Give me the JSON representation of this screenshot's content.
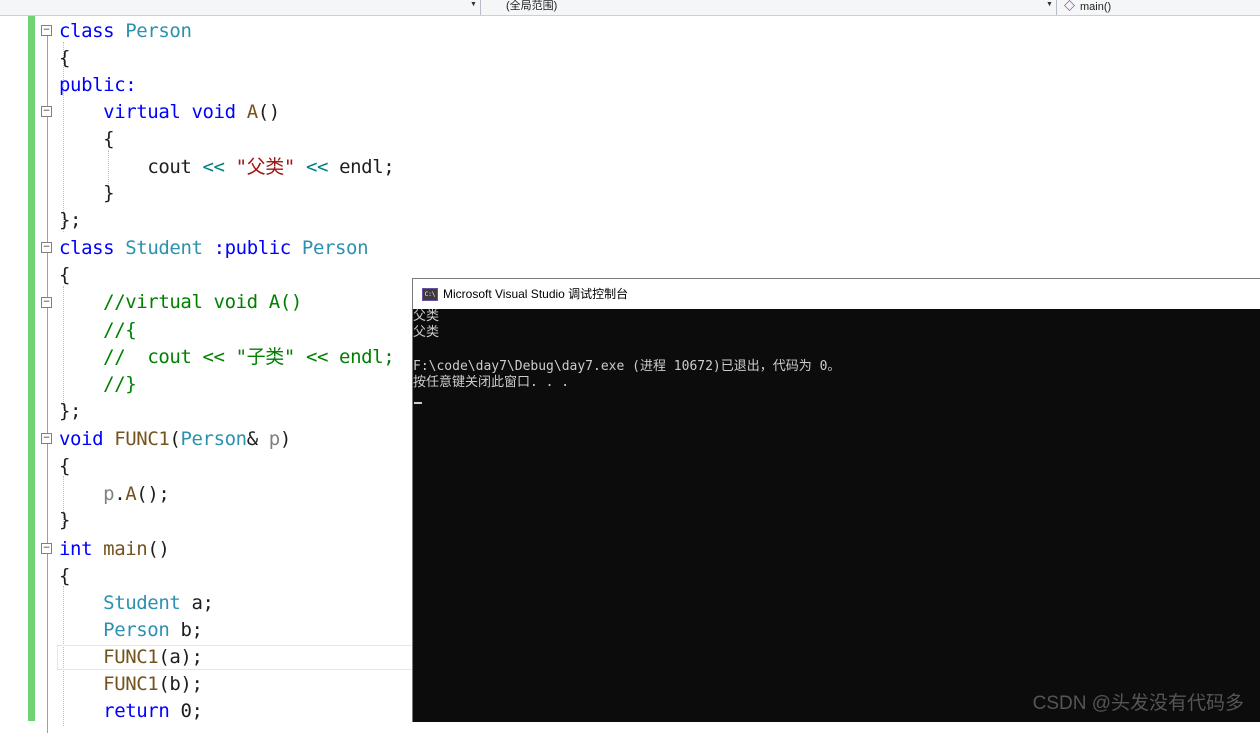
{
  "navbar": {
    "scope_label": "(全局范围)",
    "member_label": "main()"
  },
  "code": {
    "l1": "class",
    "l1b": "Person",
    "l2": "{",
    "l3": "public:",
    "l4a": "virtual",
    "l4b": "void",
    "l4c": "A",
    "l4d": "()",
    "l5": "{",
    "l6a": "cout",
    "l6b": "<<",
    "l6c": "\"父类\"",
    "l6d": "<<",
    "l6e": "endl;",
    "l7": "}",
    "l8": "};",
    "l9a": "class",
    "l9b": "Student",
    "l9c": ":public",
    "l9d": "Person",
    "l10": "{",
    "l11": "//virtual void A()",
    "l12": "//{",
    "l13a": "//",
    "l13b": "cout << \"子类\" << endl;",
    "l14": "//}",
    "l15": "};",
    "l16a": "void",
    "l16b": "FUNC1",
    "l16c": "(",
    "l16d": "Person",
    "l16e": "&",
    "l16f": "p",
    "l16g": ")",
    "l17": "{",
    "l18a": "p",
    "l18b": ".",
    "l18c": "A",
    "l18d": "();",
    "l19": "}",
    "l20a": "int",
    "l20b": "main",
    "l20c": "()",
    "l21": "{",
    "l22a": "Student",
    "l22b": "a;",
    "l23a": "Person",
    "l23b": "b;",
    "l24a": "FUNC1",
    "l24b": "(a);",
    "l25a": "FUNC1",
    "l25b": "(b);",
    "l26a": "return",
    "l26b": "0;"
  },
  "console": {
    "title": "Microsoft Visual Studio 调试控制台",
    "icon_text": "C:\\",
    "lines": [
      "父类",
      "父类",
      "",
      "F:\\code\\day7\\Debug\\day7.exe (进程 10672)已退出，代码为 0。",
      "按任意键关闭此窗口. . ."
    ]
  },
  "watermark": "CSDN @头发没有代码多",
  "colors": {
    "keyword": "#0000ff",
    "type": "#2b91af",
    "string": "#a31515",
    "comment": "#008000",
    "change_bar": "#6fd36f",
    "console_bg": "#0c0c0c"
  }
}
